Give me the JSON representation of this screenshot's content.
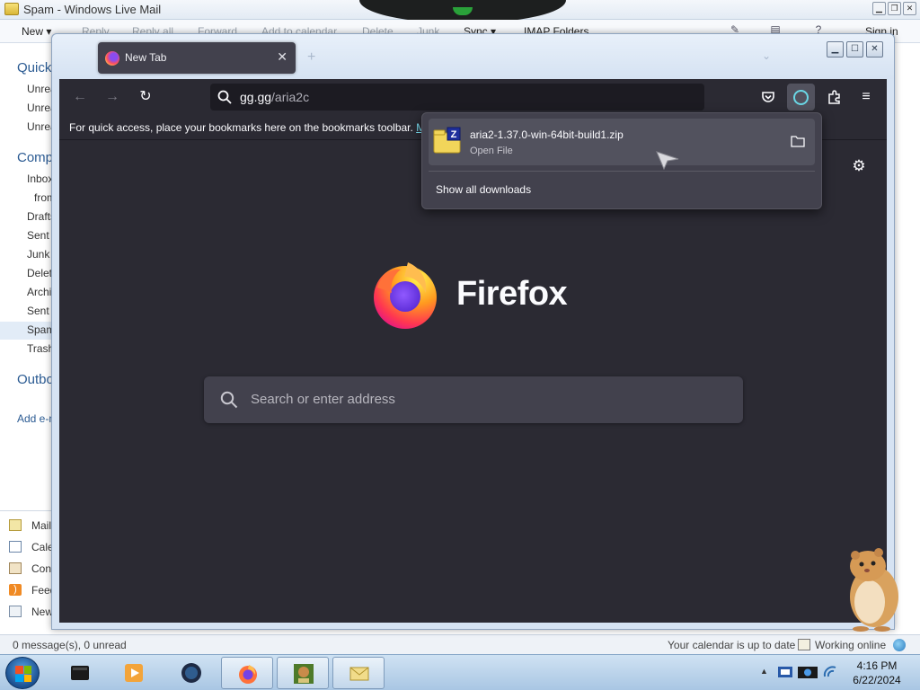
{
  "wlm": {
    "title": "Spam - Windows Live Mail",
    "window_buttons": [
      "min",
      "max",
      "close"
    ],
    "ribbon": {
      "new": "New",
      "new_caret": "▾",
      "reply": "Reply",
      "reply_all": "Reply all",
      "forward": "Forward",
      "add_to_calendar": "Add to calendar",
      "delete": "Delete",
      "junk": "Junk",
      "sync": "Sync",
      "sync_caret": "▾",
      "imap": "IMAP Folders",
      "sign_in": "Sign in"
    },
    "nav": {
      "quick_views": "Quick views",
      "quick_items": [
        "Unread e-mail",
        "Unread from contacts",
        "Unread feeds"
      ],
      "account": "Computer",
      "folders": [
        "Inbox",
        "from",
        "Drafts",
        "Sent items",
        "Junk e-mail",
        "Deleted items",
        "Archive",
        "Sent",
        "Spam",
        "Trash"
      ],
      "selected_folder": "Spam",
      "outbox": "Outbox",
      "add_account": "Add e-mail account",
      "bottom": [
        "Mail",
        "Calendar",
        "Contacts",
        "Feeds",
        "Newsgroups"
      ]
    },
    "status": {
      "left": "0 message(s), 0 unread",
      "calendar": "Your calendar is up to date",
      "online": "Working online"
    }
  },
  "firefox": {
    "tab_label": "New Tab",
    "tab_close": "✕",
    "new_tab": "+",
    "tabs_menu": "⌄",
    "url_host": "gg.gg",
    "url_path": "/aria2c",
    "bookmarks_text": "For quick access, place your bookmarks here on the bookmarks toolbar.",
    "bookmarks_link": "M",
    "wordmark": "Firefox",
    "search_placeholder": "Search or enter address",
    "downloads": {
      "filename": "aria2-1.37.0-win-64bit-build1.zip",
      "status": "Open File",
      "show_all": "Show all downloads"
    }
  },
  "taskbar": {
    "time": "4:16 PM",
    "date": "6/22/2024"
  },
  "colors": {
    "ff_bg": "#2b2a33",
    "ff_panel": "#42414d",
    "ff_accent": "#80ebff",
    "wlm_accent": "#2a5a92"
  }
}
